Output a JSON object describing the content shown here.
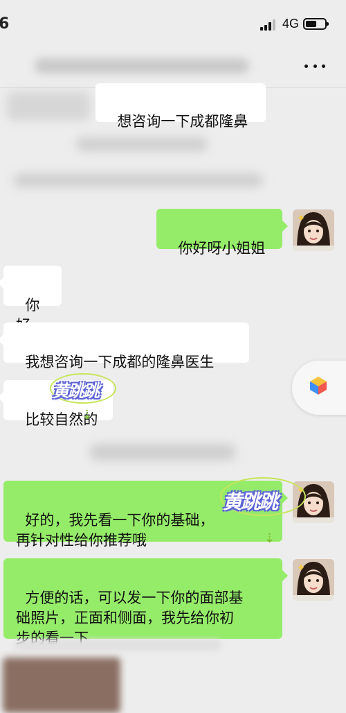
{
  "status_bar": {
    "time": "6",
    "network": "4G"
  },
  "nav": {
    "more_icon": "more-horizontal-icon"
  },
  "messages": [
    {
      "side": "left",
      "text": "想咨询一下成都隆鼻"
    },
    {
      "side": "right",
      "text": "你好呀小姐姐"
    },
    {
      "side": "left",
      "text": "你好"
    },
    {
      "side": "left",
      "text": "我想咨询一下成都的隆鼻医生"
    },
    {
      "side": "left",
      "text": "比较自然的"
    },
    {
      "side": "right",
      "text": "好的，我先看一下你的基础，\n再针对性给你推荐哦"
    },
    {
      "side": "right",
      "text": "方便的话，可以发一下你的面部基\n础照片，正面和侧面，我先给你初\n步的看一下"
    }
  ],
  "watermarks": [
    "黄跳跳",
    "黄跳跳"
  ],
  "colors": {
    "background": "#ededed",
    "bubble_self": "#95ec69",
    "bubble_other": "#ffffff"
  }
}
